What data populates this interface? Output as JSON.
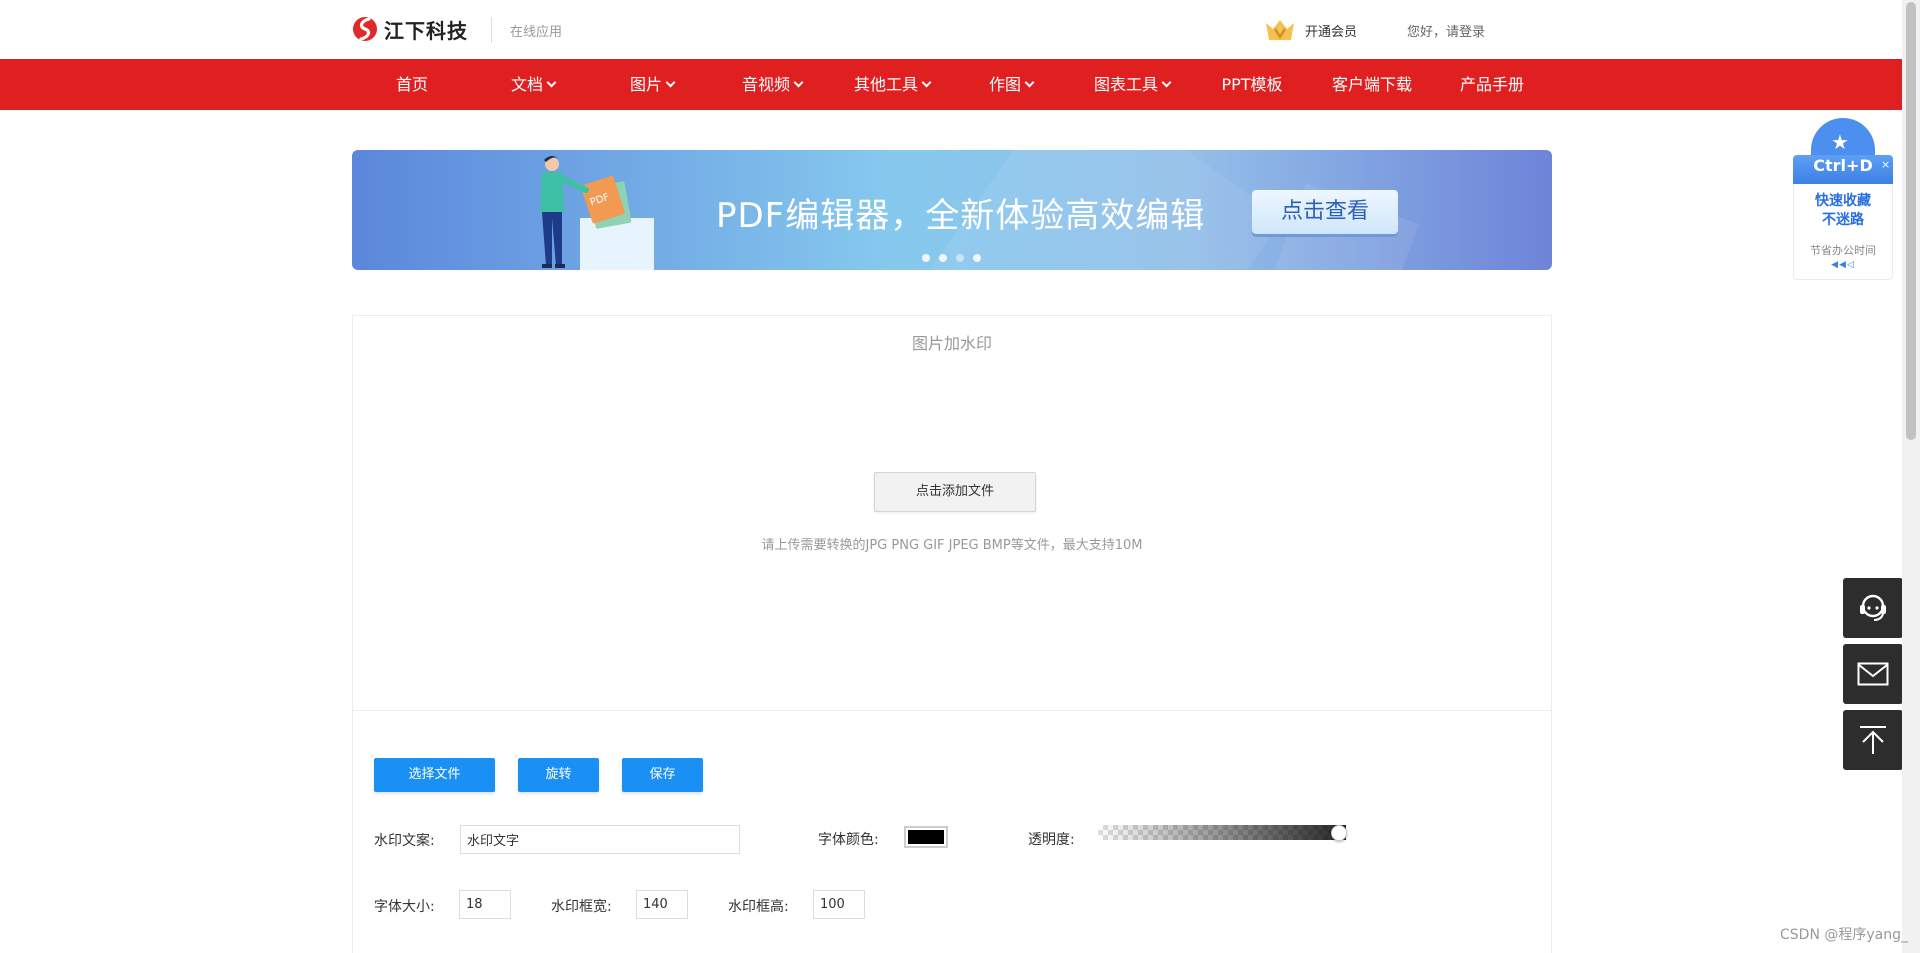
{
  "header": {
    "brand": "江下科技",
    "subtitle": "在线应用",
    "vip_label": "开通会员",
    "login_label": "您好，请登录"
  },
  "nav": {
    "items": [
      {
        "label": "首页",
        "has_dropdown": false
      },
      {
        "label": "文档",
        "has_dropdown": true
      },
      {
        "label": "图片",
        "has_dropdown": true
      },
      {
        "label": "音视频",
        "has_dropdown": true
      },
      {
        "label": "其他工具",
        "has_dropdown": true
      },
      {
        "label": "作图",
        "has_dropdown": true
      },
      {
        "label": "图表工具",
        "has_dropdown": true
      },
      {
        "label": "PPT模板",
        "has_dropdown": false
      },
      {
        "label": "客户端下载",
        "has_dropdown": false
      },
      {
        "label": "产品手册",
        "has_dropdown": false
      }
    ]
  },
  "banner": {
    "headline": "PDF编辑器，全新体验高效编辑",
    "button_label": "点击查看",
    "slides_total": 4,
    "illustration_tag": "PDF"
  },
  "tool": {
    "title": "图片加水印",
    "upload_button": "点击添加文件",
    "upload_hint": "请上传需要转换的JPG PNG GIF JPEG BMP等文件，最大支持10M",
    "actions": {
      "choose_file": "选择文件",
      "rotate": "旋转",
      "save": "保存"
    },
    "fields": {
      "watermark_text_label": "水印文案:",
      "watermark_text_value": "水印文字",
      "font_color_label": "字体颜色:",
      "font_color_value": "#000000",
      "opacity_label": "透明度:",
      "opacity_value": 1.0,
      "font_size_label": "字体大小:",
      "font_size_value": "18",
      "box_width_label": "水印框宽:",
      "box_width_value": "140",
      "box_height_label": "水印框高:",
      "box_height_value": "100"
    }
  },
  "side": {
    "favorite_key": "Ctrl+D",
    "favorite_main": "快速收藏\n不迷路",
    "favorite_line1": "快速收藏",
    "favorite_line2": "不迷路",
    "favorite_sub": "节省办公时间",
    "close_symbol": "×",
    "service_icon": "headset-icon",
    "mail_icon": "mail-icon",
    "top_icon": "arrow-up-icon"
  },
  "footer_tag": "CSDN @程序yang_",
  "colors": {
    "nav_red": "#e02020",
    "action_blue": "#1a90f5",
    "dark_widget": "#2d2d2d"
  }
}
